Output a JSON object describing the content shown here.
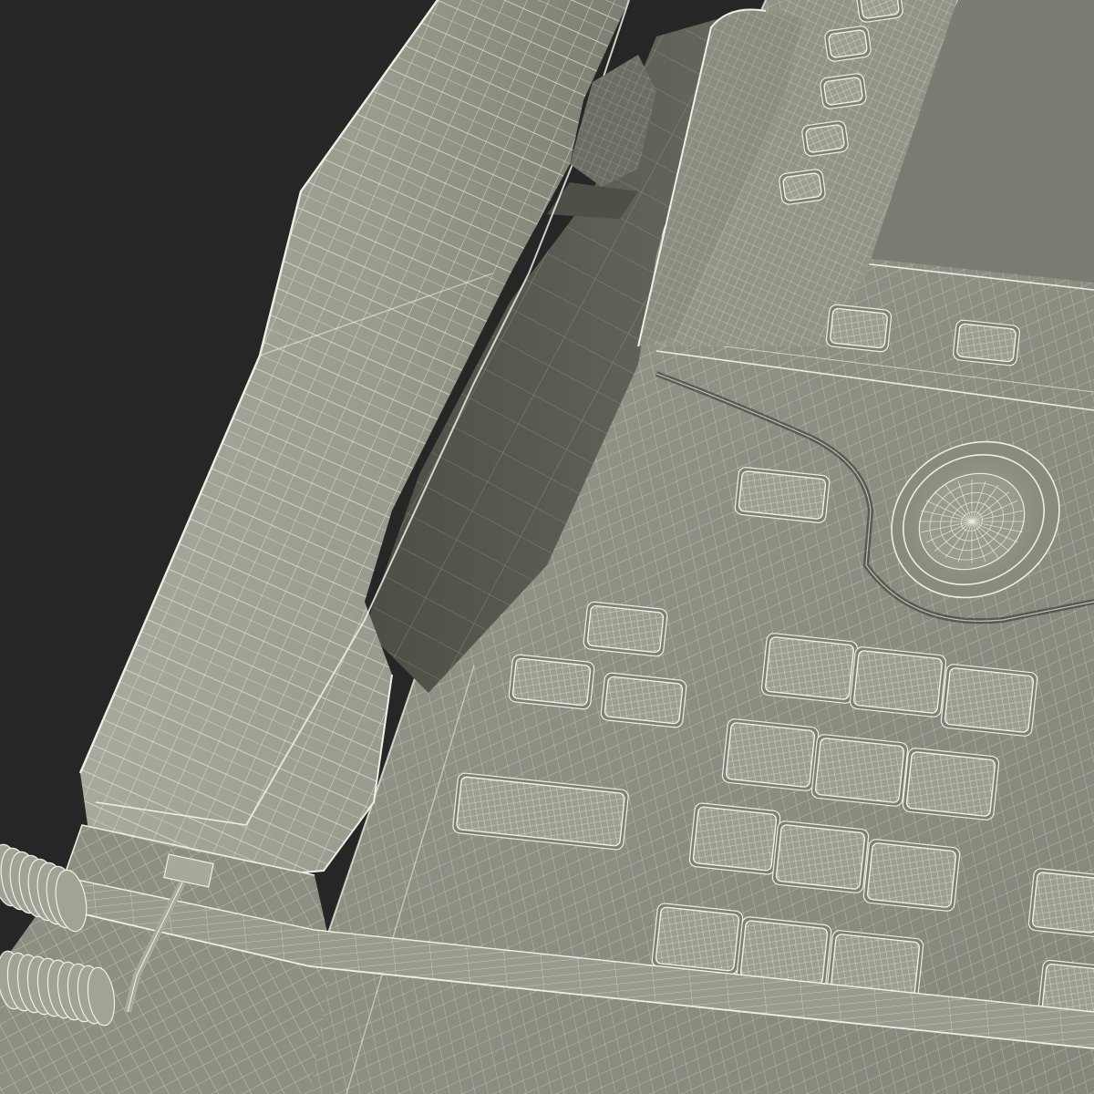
{
  "scene": {
    "subject": "ip-desk-phone",
    "render_style": "wireframe-mesh",
    "colors": {
      "background": "#262626",
      "body": "#8f8f84",
      "body_light": "#a6a69a",
      "body_dark": "#6d6d63",
      "cradle_shadow": "#55554c",
      "screen": "#7b7b71",
      "wire": "#e2e2d4"
    }
  }
}
